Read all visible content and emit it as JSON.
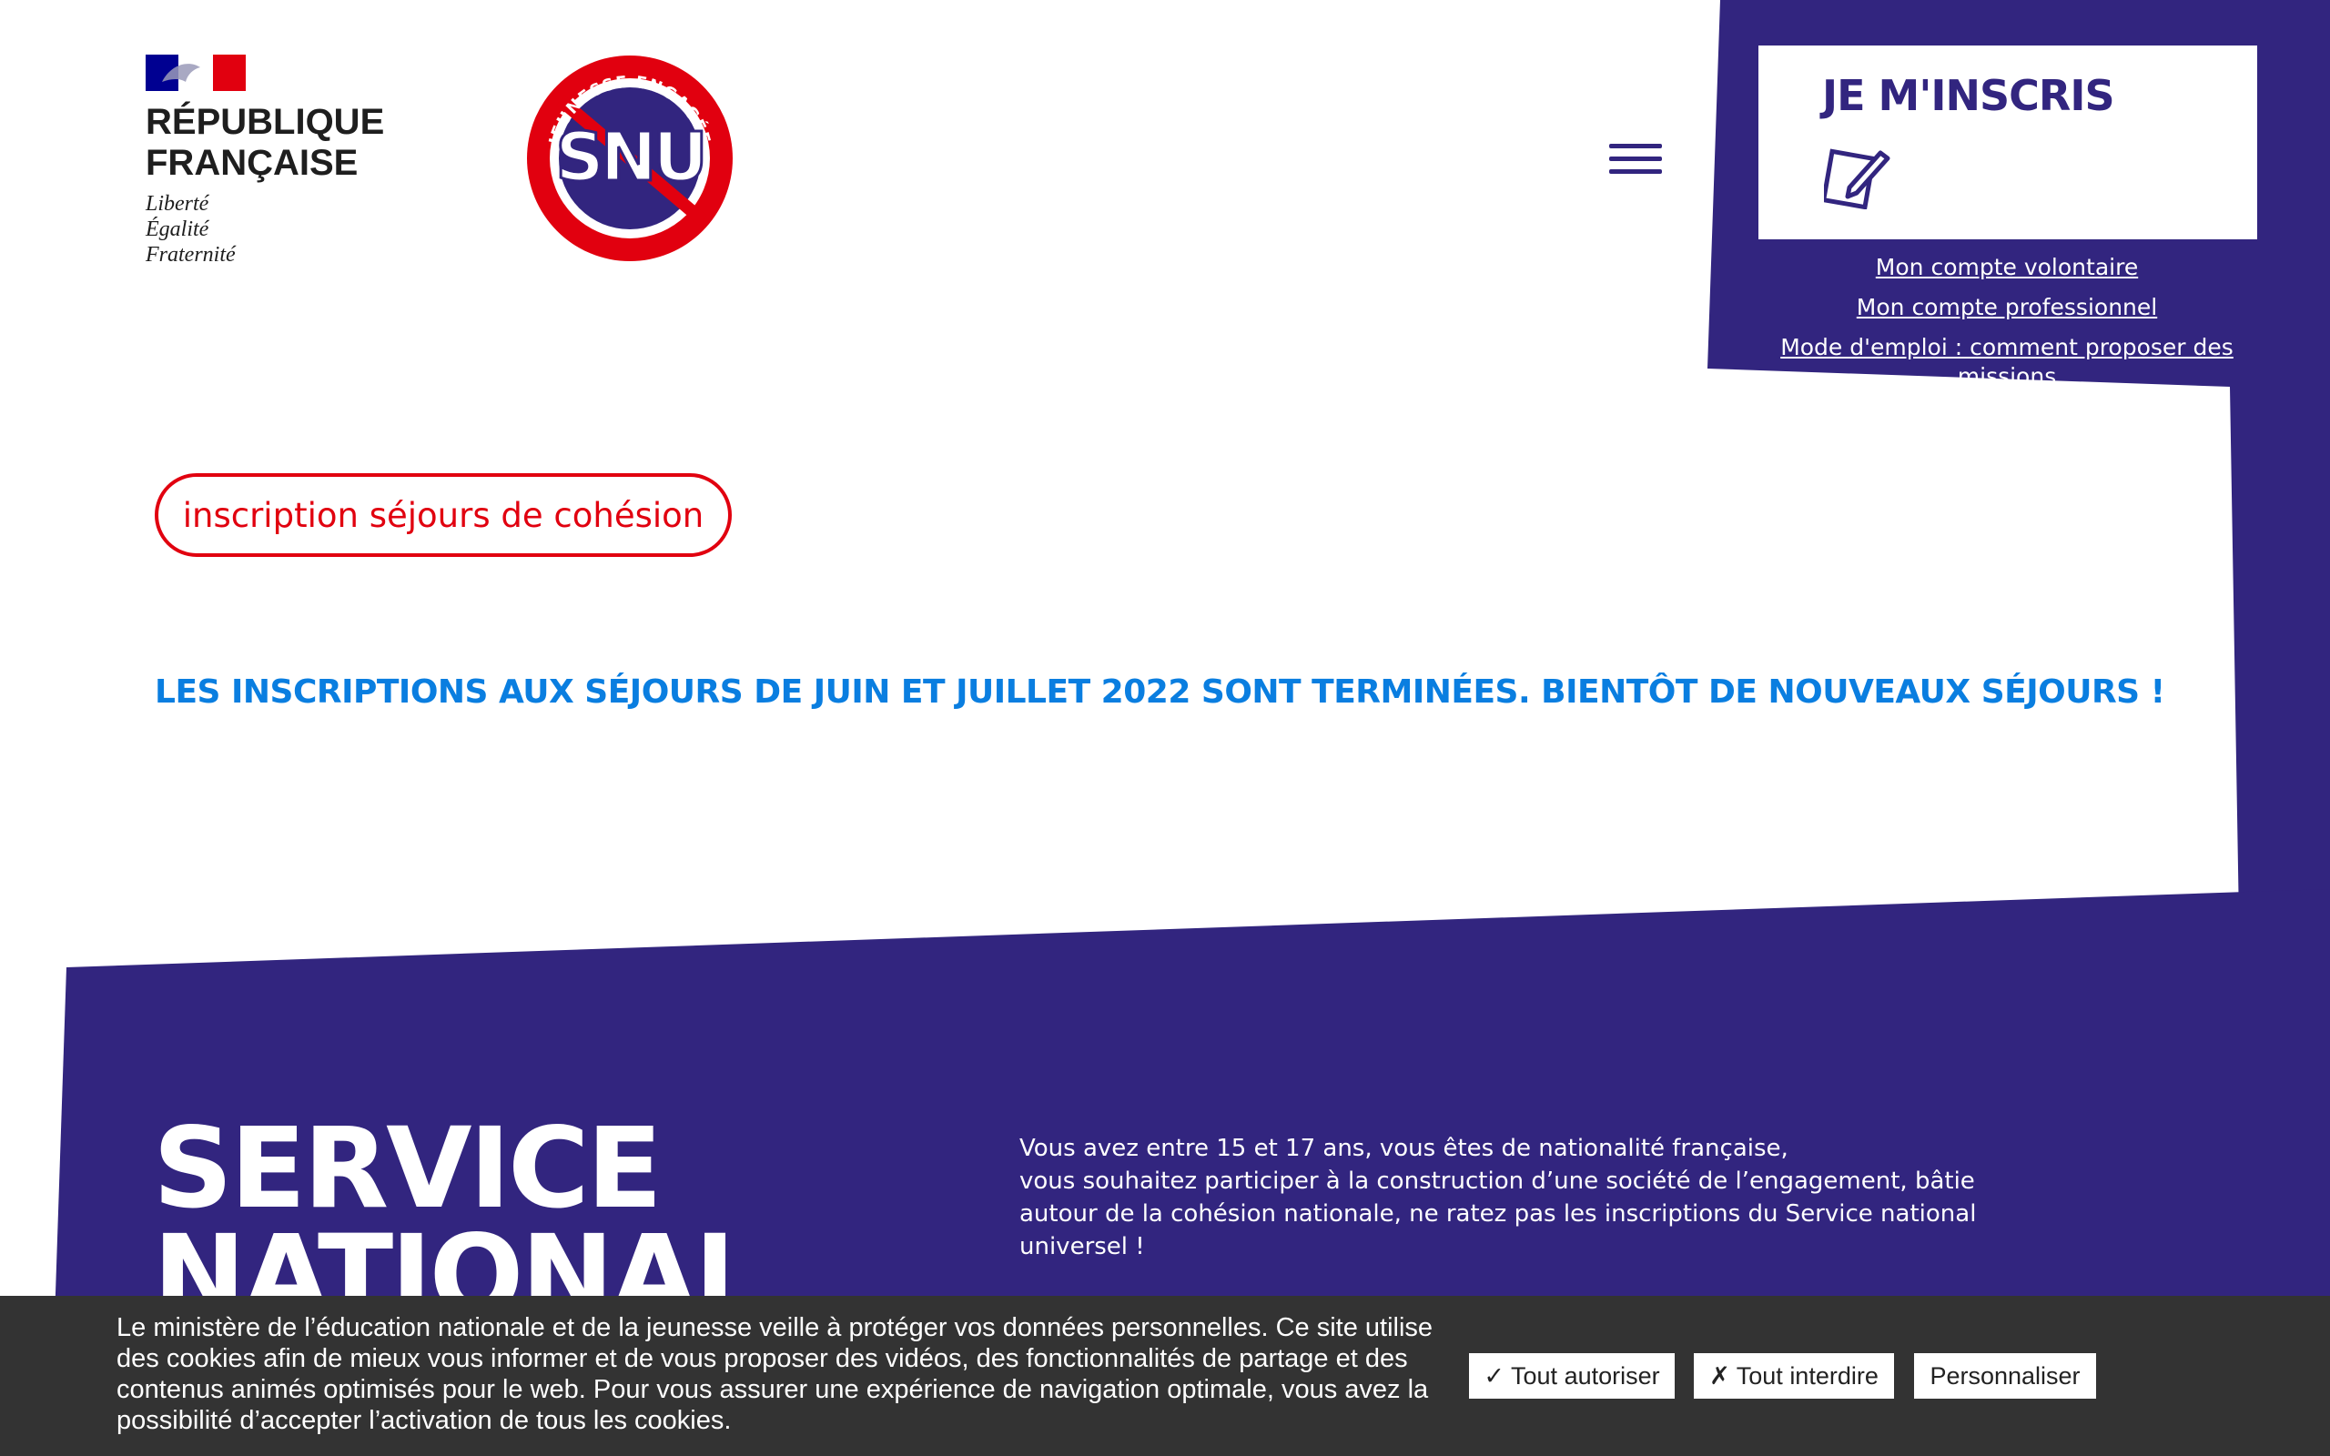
{
  "header": {
    "republique": {
      "title": "RÉPUBLIQUE\nFRANÇAISE",
      "motto": "Liberté\nÉgalité\nFraternité",
      "flag_colors": [
        "#000091",
        "#ffffff",
        "#e1000f"
      ]
    },
    "snu_logo": {
      "ring_text": "JEUNESSE ENGAGÉE",
      "letters": "SNU",
      "colors": {
        "ring": "#e1000f",
        "center": "#32257f"
      }
    },
    "menu_icon": "hamburger-icon"
  },
  "cta": {
    "label": "JE M'INSCRIS",
    "icon": "edit-form-icon"
  },
  "account_links": [
    "Mon compte volontaire",
    "Mon compte professionnel",
    "Mode d'emploi : comment proposer des missions"
  ],
  "main": {
    "pill_button": "inscription séjours de cohésion",
    "announcement": "LES INSCRIPTIONS AUX SÉJOURS DE JUIN ET JUILLET 2022 SONT TERMINÉES. BIENTÔT DE NOUVEAUX SÉJOURS !"
  },
  "hero": {
    "title": "SERVICE\nNATIONAL",
    "description": "Vous avez entre 15 et 17 ans, vous êtes de nationalité française,\nvous souhaitez participer à la construction d’une société de l’engagement, bâtie autour de la cohésion nationale, ne ratez pas les inscriptions du Service national universel !"
  },
  "cookie_banner": {
    "text": "Le ministère de l’éducation nationale et de la jeunesse veille à protéger vos données personnelles. Ce site utilise des cookies afin de mieux vous informer et de vous proposer des vidéos, des fonctionnalités de partage et des contenus animés optimisés pour le web. Pour vous assurer une expérience de navigation optimale, vous avez la possibilité d’accepter l’activation de tous les cookies.",
    "accept_all": "✓ Tout autoriser",
    "deny_all": "✗ Tout interdire",
    "customize": "Personnaliser"
  },
  "colors": {
    "purple": "#32257f",
    "red": "#e1000f",
    "blue_announcement": "#0a7ee0",
    "cookie_bg": "#333333"
  }
}
